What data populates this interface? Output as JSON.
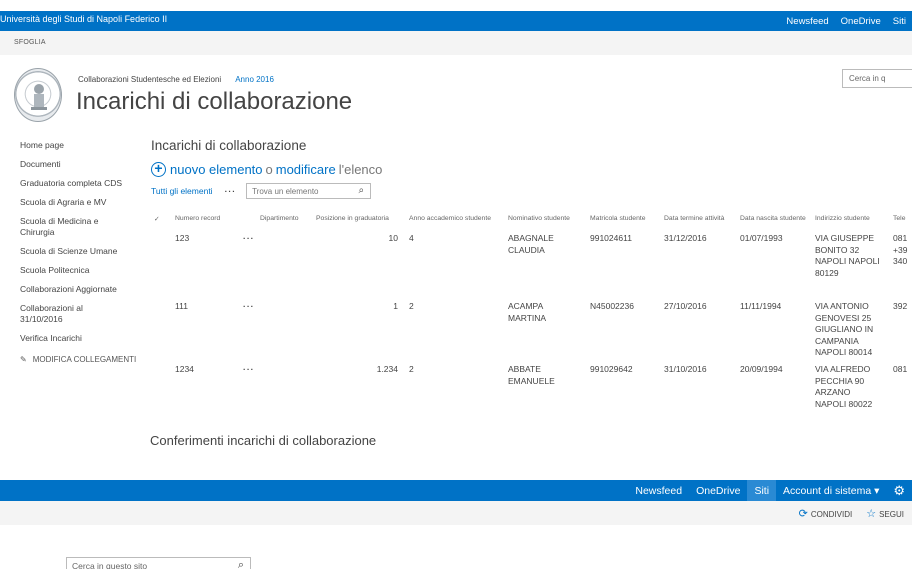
{
  "suite_top": {
    "brand": "Università degli Studi di Napoli Federico II",
    "links": [
      "Newsfeed",
      "OneDrive",
      "Siti"
    ]
  },
  "ribbon_top": {
    "tab": "SFOGLIA"
  },
  "header": {
    "breadcrumb": "Collaborazioni Studentesche ed Elezioni",
    "breadcrumb_selected": "Anno 2016",
    "title": "Incarichi di collaborazione",
    "search_placeholder": "Cerca in q"
  },
  "leftnav": {
    "items": [
      "Home page",
      "Documenti",
      "Graduatoria completa CDS",
      "Scuola di Agraria e MV",
      "Scuola di Medicina e Chirurgia",
      "Scuola di Scienze Umane",
      "Scuola Politecnica",
      "Collaborazioni Aggiornate",
      "Collaborazioni al 31/10/2016",
      "Verifica Incarichi"
    ],
    "edit_links": "MODIFICA COLLEGAMENTI"
  },
  "list": {
    "heading": "Incarichi di collaborazione",
    "new_item": "nuovo elemento",
    "or": "o",
    "edit": "modificare",
    "list_word": "l'elenco",
    "view_all": "Tutti gli elementi",
    "find_placeholder": "Trova un elemento",
    "columns": [
      "Numero record",
      "Dipartimento",
      "Posizione in graduatoria",
      "Anno accademico studente",
      "Nominativo studente",
      "Matricola studente",
      "Data termine attività",
      "Data nascita studente",
      "Indirizzio studente",
      "Tele"
    ],
    "rows": [
      {
        "record": "123",
        "posizione": "10",
        "anno": "4",
        "nome": [
          "ABAGNALE",
          "CLAUDIA"
        ],
        "matricola": "991024611",
        "termine": "31/12/2016",
        "nascita": "01/07/1993",
        "indirizzo": [
          "VIA GIUSEPPE",
          "BONITO 32",
          "NAPOLI NAPOLI",
          "80129"
        ],
        "tel": [
          "081",
          "+39",
          "340"
        ]
      },
      {
        "record": "111",
        "posizione": "1",
        "anno": "2",
        "nome": [
          "ACAMPA",
          "MARTINA"
        ],
        "matricola": "N45002236",
        "termine": "27/10/2016",
        "nascita": "11/11/1994",
        "indirizzo": [
          "VIA ANTONIO",
          "GENOVESI 25",
          "GIUGLIANO IN",
          "CAMPANIA",
          "NAPOLI 80014"
        ],
        "tel": [
          "392"
        ]
      },
      {
        "record": "1234",
        "posizione": "1.234",
        "anno": "2",
        "nome": [
          "ABBATE",
          "EMANUELE"
        ],
        "matricola": "991029642",
        "termine": "31/10/2016",
        "nascita": "20/09/1994",
        "indirizzo": [
          "VIA ALFREDO",
          "PECCHIA 90",
          "ARZANO",
          "NAPOLI 80022"
        ],
        "tel": [
          "081"
        ]
      }
    ]
  },
  "second_heading": "Conferimenti incarichi di collaborazione",
  "suite_bottom": {
    "links": [
      "Newsfeed",
      "OneDrive",
      "Siti",
      "Account di sistema ▾"
    ]
  },
  "ribbon_bottom": {
    "share": "CONDIVIDI",
    "follow": "SEGUI"
  },
  "bottom_search_placeholder": "Cerca in questo sito",
  "colors": {
    "suite_blue": "#0072c6",
    "link_blue": "#0072c6",
    "ribbon_gray": "#f4f4f4"
  }
}
